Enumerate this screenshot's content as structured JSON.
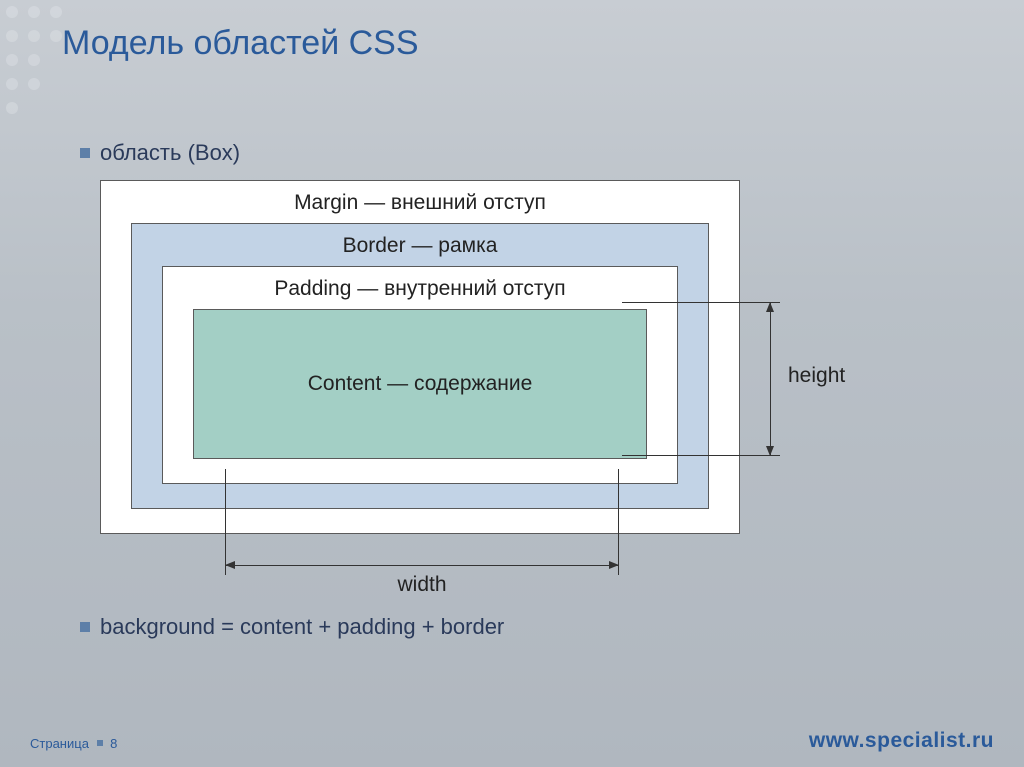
{
  "title": "Модель областей CSS",
  "bullets": {
    "box_region": "область (Box)",
    "background_eq": "background = content + padding + border"
  },
  "diagram": {
    "margin_label": "Margin — внешний отступ",
    "border_label": "Border — рамка",
    "padding_label": "Padding — внутренний отступ",
    "content_label": "Content — содержание",
    "width_label": "width",
    "height_label": "height"
  },
  "footer": {
    "page_word": "Страница",
    "page_number": "8",
    "site": "www.specialist.ru"
  }
}
